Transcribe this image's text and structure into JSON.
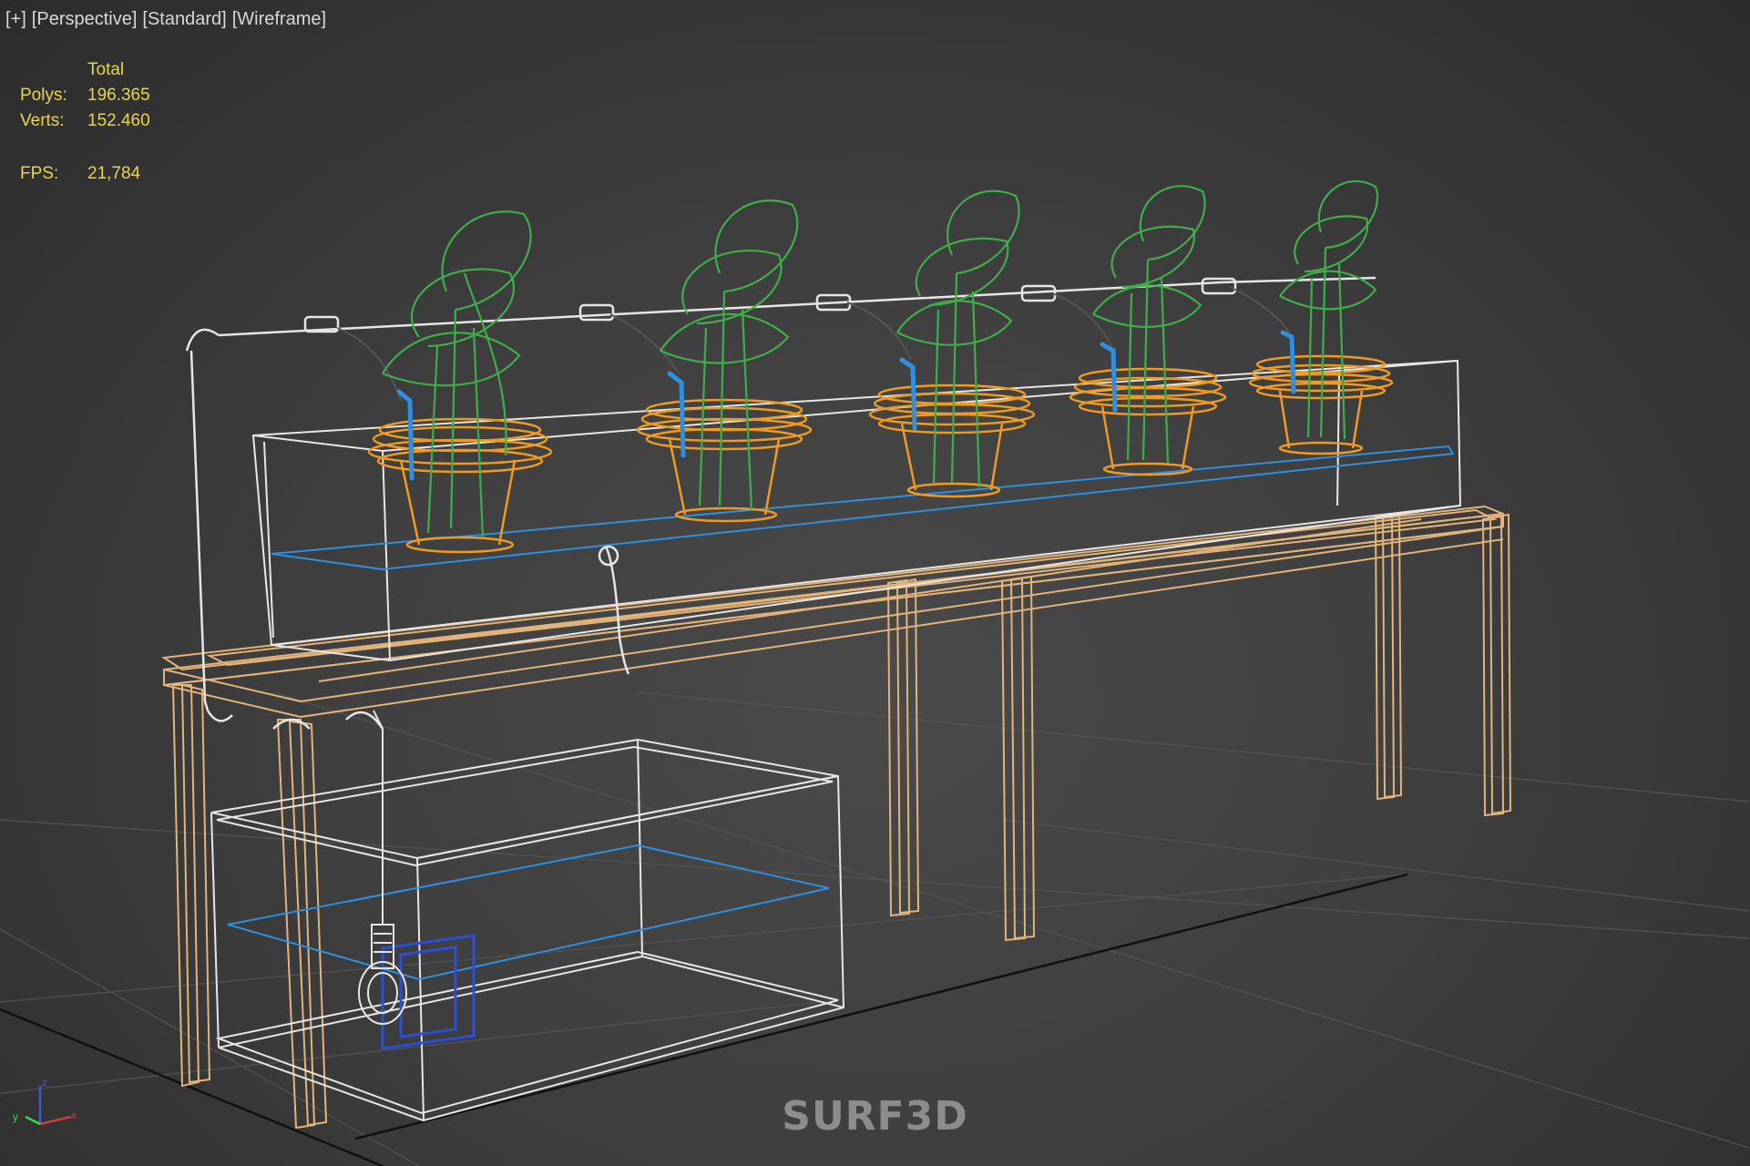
{
  "viewport": {
    "menus": [
      {
        "id": "plus",
        "label": "[+]"
      },
      {
        "id": "view",
        "label": "[Perspective]"
      },
      {
        "id": "shading",
        "label": "[Standard]"
      },
      {
        "id": "display",
        "label": "[Wireframe]"
      }
    ]
  },
  "stats": {
    "header": "Total",
    "polys_label": "Polys:",
    "polys_value": "196.365",
    "verts_label": "Verts:",
    "verts_value": "152.460",
    "fps_label": "FPS:",
    "fps_value": "21,784"
  },
  "watermark": "SURF3D",
  "gizmo": {
    "x_label": "x",
    "y_label": "y",
    "z_label": "z"
  },
  "colors": {
    "background": "#3f3f3f",
    "stats_text": "#e8d44c",
    "wire_white": "#e6e6e6",
    "wire_table": "#e3b47a",
    "wire_pot": "#f09a20",
    "wire_plant": "#3fae4a",
    "wire_water": "#2f8fe0",
    "wire_pump": "#2b4fd8"
  },
  "icons": [
    "axis-gizmo-icon"
  ]
}
